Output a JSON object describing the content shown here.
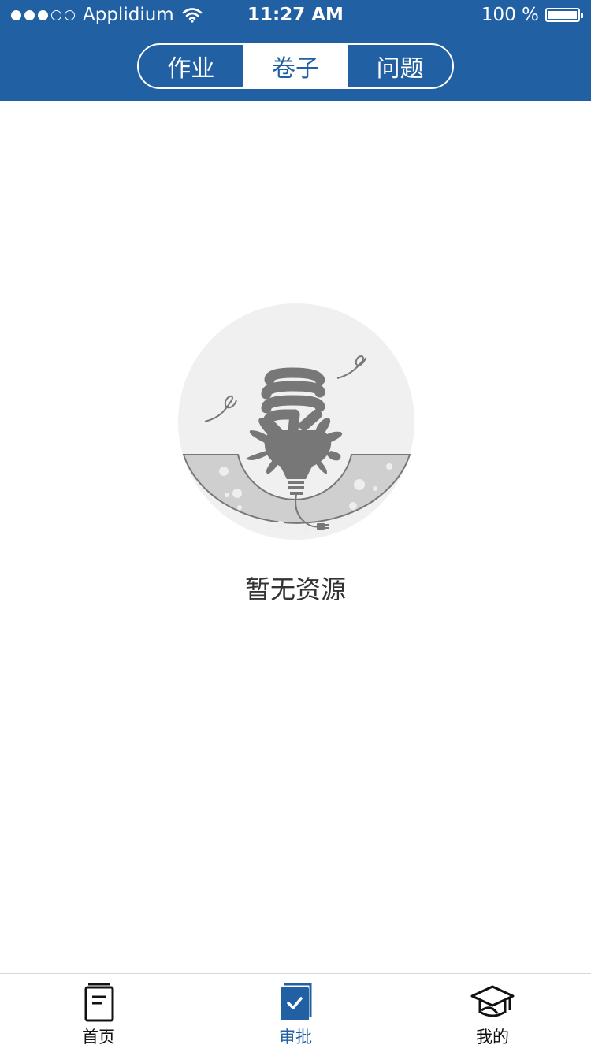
{
  "status_bar": {
    "carrier": "Applidium",
    "time": "11:27 AM",
    "battery": "100 %",
    "signal_bars_filled": 3,
    "signal_bars_total": 5
  },
  "segments": [
    {
      "label": "作业",
      "active": false
    },
    {
      "label": "卷子",
      "active": true
    },
    {
      "label": "问题",
      "active": false
    }
  ],
  "empty_state": {
    "message": "暂无资源",
    "icon": "lightbulb-plant-icon"
  },
  "tabbar": {
    "items": [
      {
        "label": "首页",
        "icon": "notebook-icon",
        "active": false
      },
      {
        "label": "审批",
        "icon": "approval-book-icon",
        "active": true
      },
      {
        "label": "我的",
        "icon": "graduation-cap-icon",
        "active": false
      }
    ]
  },
  "colors": {
    "primary": "#2160a3",
    "background": "#ffffff",
    "illustration_gray": "#777777",
    "circle_bg": "#f0f0f0",
    "ground": "#cfcfcf"
  }
}
